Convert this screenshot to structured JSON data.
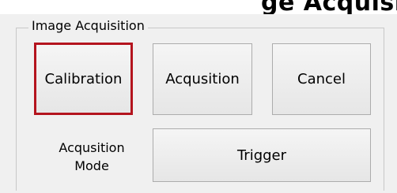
{
  "header": {
    "partial_title": "ge Acquisition"
  },
  "group": {
    "title": "Image Acquisition"
  },
  "buttons": {
    "calibration": "Calibration",
    "acquisition": "Acqusition",
    "cancel": "Cancel",
    "trigger": "Trigger"
  },
  "mode_label": {
    "line1": "Acqusition",
    "line2": "Mode"
  },
  "colors": {
    "focus_border": "#b4141e",
    "dialog_background": "#f0f0f0"
  }
}
